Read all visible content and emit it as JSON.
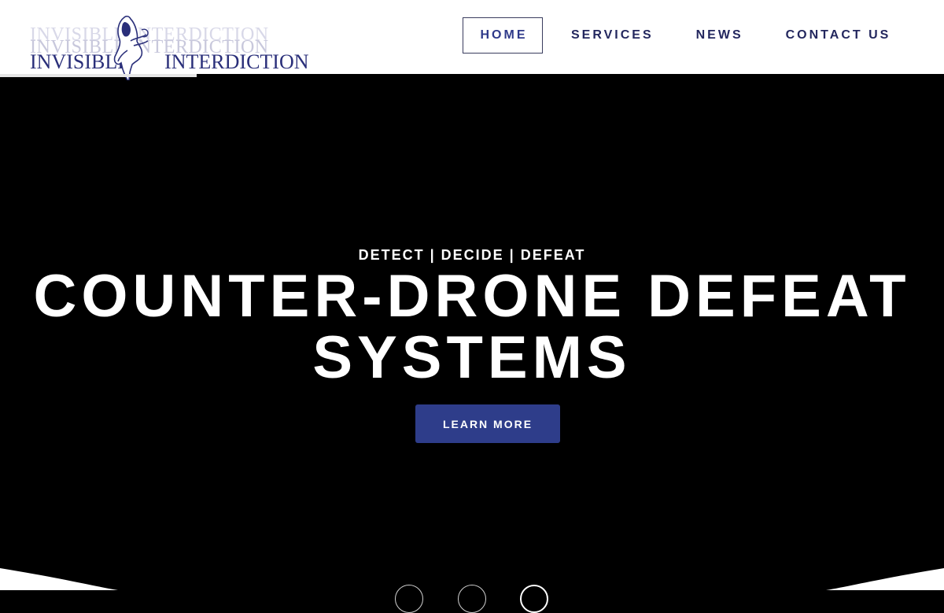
{
  "brand": {
    "logo_text_main_left": "INVISIBLE",
    "logo_text_main_right": "INTERDICTION",
    "logo_text_ghost": "INVISIBLE INTERDICTION",
    "logo_color": "#2a2f7a"
  },
  "nav": {
    "items": [
      {
        "label": "HOME",
        "active": true
      },
      {
        "label": "SERVICES",
        "active": false
      },
      {
        "label": "NEWS",
        "active": false
      },
      {
        "label": "CONTACT US",
        "active": false
      }
    ],
    "text_color": "#23275e"
  },
  "hero": {
    "tagline": "DETECT | DECIDE | DEFEAT",
    "headline_line1": "COUNTER-DRONE DEFEAT",
    "headline_line2": "SYSTEMS",
    "cta_label": "LEARN MORE",
    "cta_color": "#2e3d8a",
    "background_color": "#000000"
  },
  "slider": {
    "slide_count": 3,
    "active_index": 2
  }
}
